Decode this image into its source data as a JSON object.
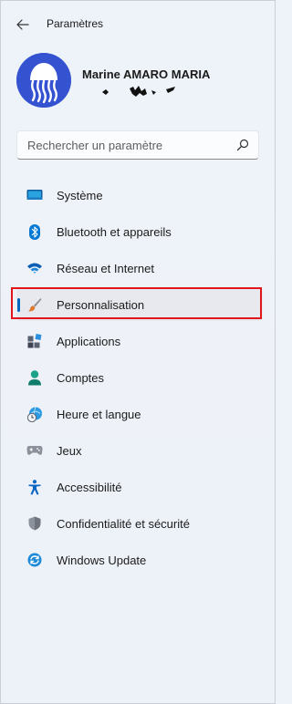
{
  "window": {
    "title": "Paramètres"
  },
  "profile": {
    "name": "Marine AMARO MARIA"
  },
  "search": {
    "placeholder": "Rechercher un paramètre"
  },
  "nav": {
    "items": [
      {
        "label": "Système",
        "icon": "monitor-icon"
      },
      {
        "label": "Bluetooth et appareils",
        "icon": "bluetooth-icon"
      },
      {
        "label": "Réseau et Internet",
        "icon": "wifi-icon"
      },
      {
        "label": "Personnalisation",
        "icon": "brush-icon",
        "selected": true
      },
      {
        "label": "Applications",
        "icon": "apps-icon"
      },
      {
        "label": "Comptes",
        "icon": "person-icon"
      },
      {
        "label": "Heure et langue",
        "icon": "clock-globe-icon"
      },
      {
        "label": "Jeux",
        "icon": "gamepad-icon"
      },
      {
        "label": "Accessibilité",
        "icon": "accessibility-icon"
      },
      {
        "label": "Confidentialité et sécurité",
        "icon": "shield-icon"
      },
      {
        "label": "Windows Update",
        "icon": "update-icon"
      }
    ]
  },
  "colors": {
    "accent": "#0067c0",
    "annotation": "#e3151c",
    "background": "#eef2f9"
  }
}
